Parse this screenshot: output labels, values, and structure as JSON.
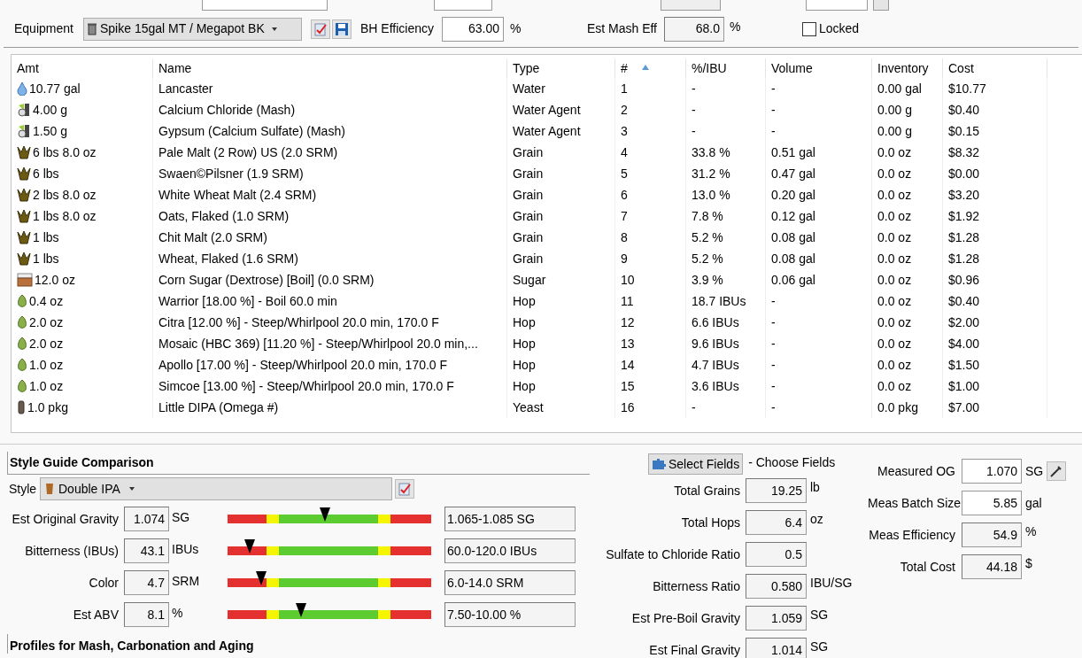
{
  "recipe": {
    "equipment": {
      "label": "Equipment",
      "value": "Spike 15gal MT / Megapot BK"
    },
    "bh_efficiency": {
      "label": "BH Efficiency",
      "value": "63.00",
      "unit": "%"
    },
    "est_mash_eff": {
      "label": "Est Mash Eff",
      "value": "68.0",
      "unit": "%"
    },
    "locked": {
      "label": "Locked",
      "checked": false
    }
  },
  "ingredients": {
    "columns": [
      {
        "label": "Amt",
        "sorted": false
      },
      {
        "label": "Name",
        "sorted": false
      },
      {
        "label": "Type",
        "sorted": false
      },
      {
        "label": "#",
        "sorted": true
      },
      {
        "label": "%/IBU",
        "sorted": false
      },
      {
        "label": "Volume",
        "sorted": false
      },
      {
        "label": "Inventory",
        "sorted": false
      },
      {
        "label": "Cost",
        "sorted": false
      }
    ],
    "rows": [
      {
        "kind": "water",
        "amt": "10.77 gal",
        "name": "Lancaster",
        "type": "Water",
        "num": "1",
        "pct": "-",
        "volume": "-",
        "inventory": "0.00 gal",
        "cost": "$10.77"
      },
      {
        "kind": "agent",
        "amt": "4.00 g",
        "name": "Calcium Chloride (Mash)",
        "type": "Water Agent",
        "num": "2",
        "pct": "-",
        "volume": "-",
        "inventory": "0.00 g",
        "cost": "$0.40"
      },
      {
        "kind": "agent",
        "amt": "1.50 g",
        "name": "Gypsum (Calcium Sulfate) (Mash)",
        "type": "Water Agent",
        "num": "3",
        "pct": "-",
        "volume": "-",
        "inventory": "0.00 g",
        "cost": "$0.15"
      },
      {
        "kind": "grain",
        "amt": "6 lbs 8.0 oz",
        "name": "Pale Malt (2 Row) US (2.0 SRM)",
        "type": "Grain",
        "num": "4",
        "pct": "33.8 %",
        "volume": "0.51 gal",
        "inventory": "0.0 oz",
        "cost": "$8.32"
      },
      {
        "kind": "grain",
        "amt": "6 lbs",
        "name": "Swaen©Pilsner (1.9 SRM)",
        "type": "Grain",
        "num": "5",
        "pct": "31.2 %",
        "volume": "0.47 gal",
        "inventory": "0.0 oz",
        "cost": "$0.00"
      },
      {
        "kind": "grain",
        "amt": "2 lbs 8.0 oz",
        "name": "White Wheat Malt (2.4 SRM)",
        "type": "Grain",
        "num": "6",
        "pct": "13.0 %",
        "volume": "0.20 gal",
        "inventory": "0.0 oz",
        "cost": "$3.20"
      },
      {
        "kind": "grain",
        "amt": "1 lbs 8.0 oz",
        "name": "Oats, Flaked (1.0 SRM)",
        "type": "Grain",
        "num": "7",
        "pct": "7.8 %",
        "volume": "0.12 gal",
        "inventory": "0.0 oz",
        "cost": "$1.92"
      },
      {
        "kind": "grain",
        "amt": "1 lbs",
        "name": "Chit Malt (2.0 SRM)",
        "type": "Grain",
        "num": "8",
        "pct": "5.2 %",
        "volume": "0.08 gal",
        "inventory": "0.0 oz",
        "cost": "$1.28"
      },
      {
        "kind": "grain",
        "amt": "1 lbs",
        "name": "Wheat, Flaked (1.6 SRM)",
        "type": "Grain",
        "num": "9",
        "pct": "5.2 %",
        "volume": "0.08 gal",
        "inventory": "0.0 oz",
        "cost": "$1.28"
      },
      {
        "kind": "sugar",
        "amt": "12.0 oz",
        "name": "Corn Sugar (Dextrose) [Boil] (0.0 SRM)",
        "type": "Sugar",
        "num": "10",
        "pct": "3.9 %",
        "volume": "0.06 gal",
        "inventory": "0.0 oz",
        "cost": "$0.96"
      },
      {
        "kind": "hop",
        "amt": "0.4 oz",
        "name": "Warrior [18.00 %] - Boil 60.0 min",
        "type": "Hop",
        "num": "11",
        "pct": "18.7 IBUs",
        "volume": "-",
        "inventory": "0.0 oz",
        "cost": "$0.40"
      },
      {
        "kind": "hop",
        "amt": "2.0 oz",
        "name": "Citra [12.00 %] - Steep/Whirlpool  20.0 min, 170.0 F",
        "type": "Hop",
        "num": "12",
        "pct": "6.6 IBUs",
        "volume": "-",
        "inventory": "0.0 oz",
        "cost": "$2.00"
      },
      {
        "kind": "hop",
        "amt": "2.0 oz",
        "name": "Mosaic (HBC 369) [11.20 %] - Steep/Whirlpool  20.0 min,...",
        "type": "Hop",
        "num": "13",
        "pct": "9.6 IBUs",
        "volume": "-",
        "inventory": "0.0 oz",
        "cost": "$4.00"
      },
      {
        "kind": "hop",
        "amt": "1.0 oz",
        "name": "Apollo [17.00 %] - Steep/Whirlpool  20.0 min, 170.0 F",
        "type": "Hop",
        "num": "14",
        "pct": "4.7 IBUs",
        "volume": "-",
        "inventory": "0.0 oz",
        "cost": "$1.50"
      },
      {
        "kind": "hop",
        "amt": "1.0 oz",
        "name": "Simcoe [13.00 %] - Steep/Whirlpool  20.0 min, 170.0 F",
        "type": "Hop",
        "num": "15",
        "pct": "3.6 IBUs",
        "volume": "-",
        "inventory": "0.0 oz",
        "cost": "$1.00"
      },
      {
        "kind": "yeast",
        "amt": "1.0 pkg",
        "name": "Little DIPA (Omega #)",
        "type": "Yeast",
        "num": "16",
        "pct": "-",
        "volume": "-",
        "inventory": "0.0 pkg",
        "cost": "$7.00"
      }
    ]
  },
  "style_guide": {
    "title": "Style Guide Comparison",
    "style": {
      "label": "Style",
      "value": "Double IPA"
    },
    "rows": [
      {
        "label": "Est Original Gravity",
        "value": "1.074",
        "unit": "SG",
        "level": 0.48,
        "range": "1.065-1.085 SG"
      },
      {
        "label": "Bitterness (IBUs)",
        "value": "43.1",
        "unit": "IBUs",
        "level": 0.11,
        "range": "60.0-120.0 IBUs"
      },
      {
        "label": "Color",
        "value": "4.7",
        "unit": "SRM",
        "level": 0.165,
        "range": "6.0-14.0 SRM"
      },
      {
        "label": "Est ABV",
        "value": "8.1",
        "unit": "%",
        "level": 0.36,
        "range": "7.50-10.00 %"
      }
    ]
  },
  "profiles": {
    "title": "Profiles for Mash, Carbonation and Aging"
  },
  "stats": {
    "select_fields": "Select Fields",
    "choose_fields": "- Choose Fields",
    "rows": [
      {
        "label": "Total Grains",
        "value": "19.25",
        "unit": "lb"
      },
      {
        "label": "Total Hops",
        "value": "6.4",
        "unit": "oz"
      },
      {
        "label": "Sulfate to Chloride Ratio",
        "value": "0.5"
      },
      {
        "label": "Bitterness Ratio",
        "value": "0.580",
        "unit": "IBU/SG"
      },
      {
        "label": "Est Pre-Boil Gravity",
        "value": "1.059",
        "unit": "SG"
      },
      {
        "label": "Est Final Gravity",
        "value": "1.014",
        "unit": "SG"
      }
    ]
  },
  "measured": {
    "rows": [
      {
        "label": "Measured OG",
        "value": "1.070",
        "unit": "SG",
        "readonly": false,
        "tool": true
      },
      {
        "label": "Meas Batch Size",
        "value": "5.85",
        "unit": "gal",
        "readonly": false,
        "tool": false
      },
      {
        "label": "Meas Efficiency",
        "value": "54.9",
        "unit": "%",
        "readonly": true,
        "tool": false
      },
      {
        "label": "Total Cost",
        "value": "44.18",
        "unit": "$",
        "readonly": true,
        "tool": false
      }
    ]
  }
}
